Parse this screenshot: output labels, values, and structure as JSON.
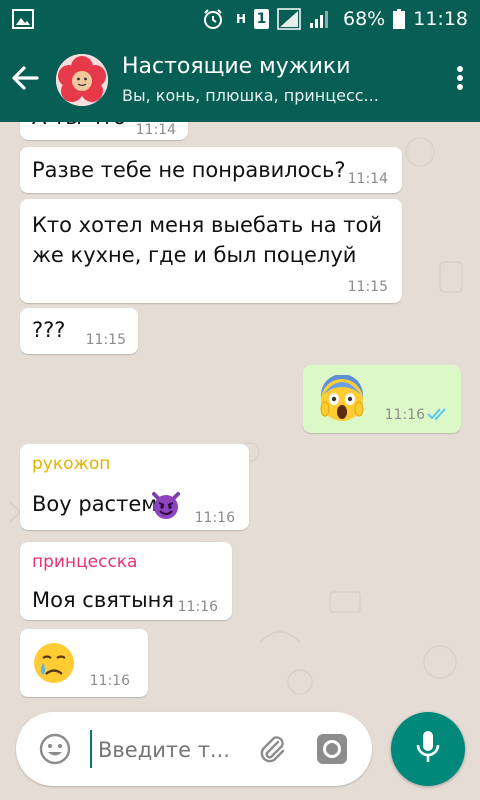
{
  "status_bar": {
    "network_type": "H",
    "sim_slot": "1",
    "battery_percent": "68%",
    "time": "11:18"
  },
  "header": {
    "title": "Настоящие мужики",
    "subtitle": "Вы, конь, плюшка, принцесс..."
  },
  "messages": [
    {
      "text": "А ты что",
      "time": "11:14",
      "direction": "in"
    },
    {
      "text": "Разве тебе не понравилось?",
      "time": "11:14",
      "direction": "in"
    },
    {
      "text_line1": "Кто хотел меня выебать на той",
      "text_line2": "же кухне, где и был поцелуй",
      "time": "11:15",
      "direction": "in"
    },
    {
      "text": "???",
      "time": "11:15",
      "direction": "in"
    },
    {
      "emoji": "scream",
      "time": "11:16",
      "direction": "out",
      "status": "read"
    },
    {
      "sender": "рукожоп",
      "sender_color": "#e0b400",
      "text": "Воу растем",
      "emoji": "smiling-imp",
      "time": "11:16",
      "direction": "in"
    },
    {
      "sender": "принцесска",
      "sender_color": "#e8336d",
      "text": "Моя святыня",
      "time": "11:16",
      "direction": "in"
    },
    {
      "emoji": "crying-face",
      "time": "11:16",
      "direction": "in"
    }
  ],
  "composer": {
    "placeholder": "Введите т..."
  },
  "colors": {
    "header": "#075e54",
    "outgoing_bubble": "#dcf8c6",
    "read_ticks": "#4fc3f7",
    "mic_button": "#00897b"
  }
}
